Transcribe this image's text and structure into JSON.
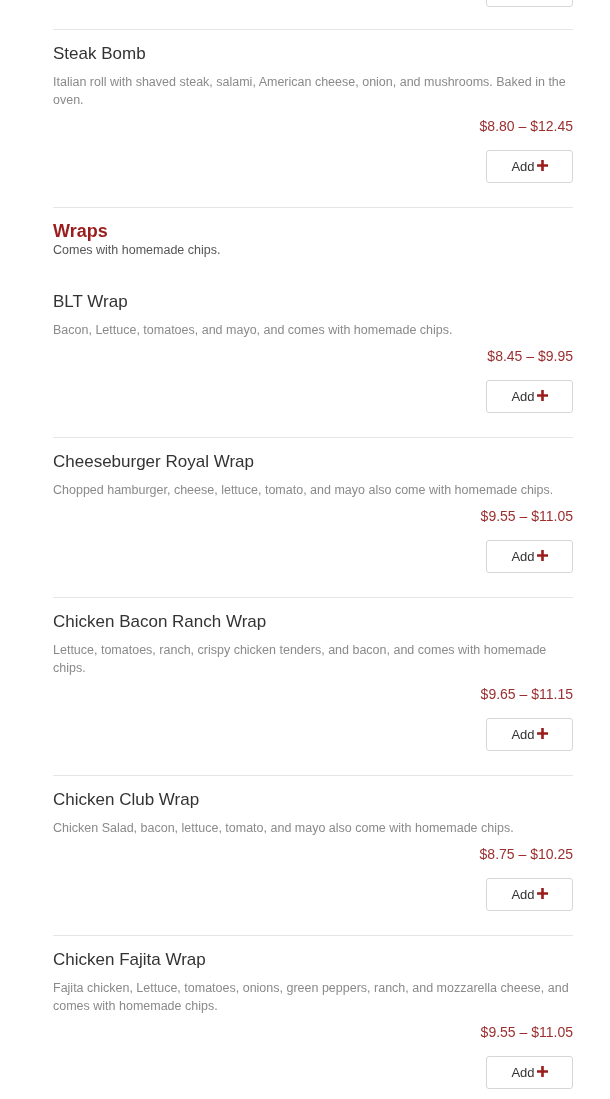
{
  "items_before": [
    {
      "name": "Steak Bomb",
      "description": "Italian roll with shaved steak, salami, American cheese, onion, and mushrooms.  Baked in the oven.",
      "price": "$8.80 – $12.45",
      "button": "Add"
    }
  ],
  "section": {
    "title": "Wraps",
    "subtitle": "Comes with homemade chips.",
    "items": [
      {
        "name": "BLT Wrap",
        "description": "Bacon, Lettuce, tomatoes, and mayo, and comes with homemade chips.",
        "price": "$8.45 – $9.95",
        "button": "Add"
      },
      {
        "name": "Cheeseburger Royal Wrap",
        "description": "Chopped hamburger, cheese, lettuce, tomato, and mayo also come with homemade chips.",
        "price": "$9.55 – $11.05",
        "button": "Add"
      },
      {
        "name": "Chicken Bacon Ranch Wrap",
        "description": "Lettuce, tomatoes, ranch, crispy chicken tenders, and bacon, and comes with homemade chips.",
        "price": "$9.65 – $11.15",
        "button": "Add"
      },
      {
        "name": "Chicken Club Wrap",
        "description": "Chicken Salad, bacon, lettuce, tomato, and mayo also come with homemade chips.",
        "price": "$8.75 – $10.25",
        "button": "Add"
      },
      {
        "name": "Chicken Fajita Wrap",
        "description": "Fajita chicken, Lettuce, tomatoes, onions, green peppers, ranch, and mozzarella cheese, and comes with homemade chips.",
        "price": "$9.55 – $11.05",
        "button": "Add"
      }
    ]
  }
}
